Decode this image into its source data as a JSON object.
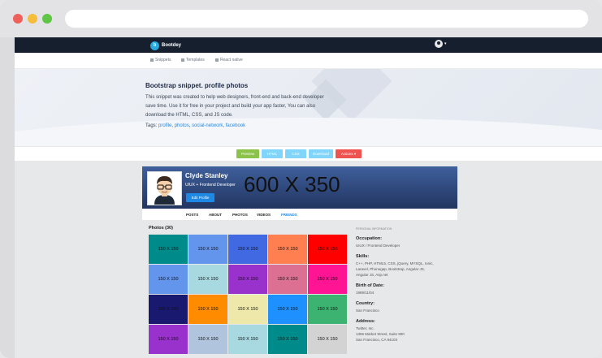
{
  "navbar": {
    "brand": "Bootdey",
    "brand_logo": "b"
  },
  "subnav": {
    "items": [
      "Snippets",
      "Templates",
      "React native"
    ]
  },
  "hero": {
    "title": "Bootstrap snippet. profile photos",
    "description": "This snippet was created to help web designers, front-end and back-end developer save time. Use it for free in your project and build your app faster, You can also download the HTML, CSS, and JS code.",
    "tags_label": "Tags:",
    "tags": [
      "profile",
      "photos",
      "social-network",
      "facebook"
    ]
  },
  "buttons": {
    "preview": "Preview",
    "html": "HTML",
    "css": "CSS",
    "download": "Download",
    "actions": "Actions ▾"
  },
  "profile": {
    "cover_text": "600 X 350",
    "name": "Clyde Stanley",
    "role": "UIUX + Frontend Developer",
    "edit_label": "Edit Profile"
  },
  "tabs": [
    "POSTS",
    "ABOUT",
    "PHOTOS",
    "VIDEOS",
    "FRIENDS"
  ],
  "photos": {
    "title": "Photos (30)",
    "label": "150 X 150",
    "colors": [
      [
        "#008b8b",
        "#6495ed",
        "#4169e1",
        "#ff7f50",
        "#ff0000"
      ],
      [
        "#6495ed",
        "#a8d8e0",
        "#9932cc",
        "#db7093",
        "#ff1493"
      ],
      [
        "#191970",
        "#ff8c00",
        "#eee8aa",
        "#1e90ff",
        "#3cb371"
      ],
      [
        "#9932cc",
        "#b0c4de",
        "#a8d8e0",
        "#008b8b",
        "#d3d3d3"
      ]
    ]
  },
  "info": {
    "header": "PERSONAL INFORMATION",
    "occupation_label": "Occupation:",
    "occupation": "UIUX / Frontend Developer",
    "skills_label": "Skills:",
    "skills": [
      "C++, PHP, HTML5, CSS, jQuery, MYSQL, Ionic,",
      "Laravel, Phonegap, Bootstrap, Angular JS,",
      "Angular JS, Asp.net"
    ],
    "birth_label": "Birth of Date:",
    "birth": "1989/11/04",
    "country_label": "Country:",
    "country": "San Francisco",
    "address_label": "Address:",
    "address": [
      "Twitter, Inc.",
      "1355 Market Street, Suite 900",
      "San Francisco, CA 94103"
    ]
  }
}
